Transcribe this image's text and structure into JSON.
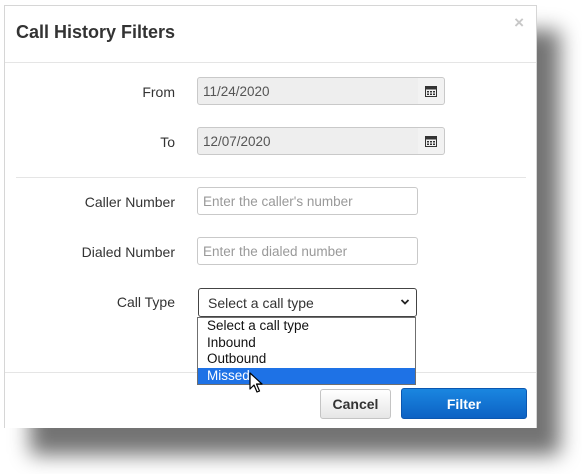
{
  "dialog": {
    "title": "Call History Filters",
    "close_glyph": "×"
  },
  "form": {
    "from": {
      "label": "From",
      "value": "11/24/2020",
      "icon": "calendar-icon"
    },
    "to": {
      "label": "To",
      "value": "12/07/2020",
      "icon": "calendar-icon"
    },
    "caller_number": {
      "label": "Caller Number",
      "placeholder": "Enter the caller's number"
    },
    "dialed_number": {
      "label": "Dialed Number",
      "placeholder": "Enter the dialed number"
    },
    "call_type": {
      "label": "Call Type",
      "selected": "Select a call type",
      "options": [
        "Select a call type",
        "Inbound",
        "Outbound",
        "Missed"
      ],
      "highlighted": "Missed"
    }
  },
  "footer": {
    "cancel_label": "Cancel",
    "filter_label": "Filter"
  },
  "colors": {
    "primary": "#1570d8",
    "highlight": "#1e72e6"
  }
}
